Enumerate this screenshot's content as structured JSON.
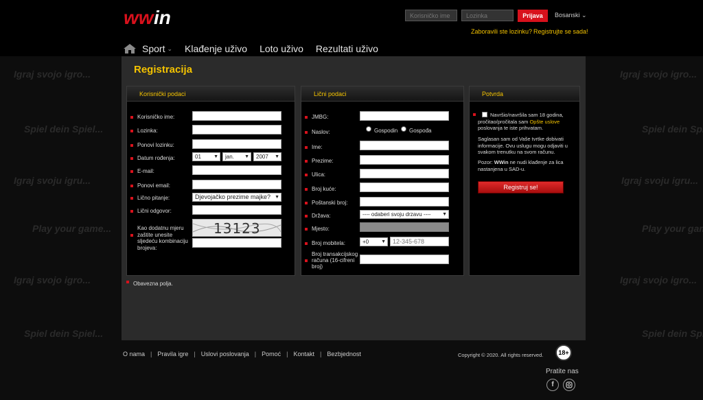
{
  "header": {
    "logo_text": "WWIN",
    "username_placeholder": "Korisničko ime",
    "password_placeholder": "Lozinka",
    "login_label": "Prijava",
    "language": "Bosanski",
    "forgot_password": "Zaboravili ste lozinku?",
    "register_now": "Registrujte se sada!"
  },
  "nav": {
    "items": [
      "Sport",
      "Klađenje uživo",
      "Loto uživo",
      "Rezultati uživo"
    ]
  },
  "background_text": {
    "a": "Igraj svojo igro...",
    "b": "Spiel dein Spiel...",
    "c": "Igraj svoju igru...",
    "d": "Play your game..."
  },
  "page_title": "Registracija",
  "account": {
    "heading": "Korisnički podaci",
    "username_label": "Korisničko ime:",
    "password_label": "Lozinka:",
    "repeat_password_label": "Ponovi lozinku:",
    "dob_label": "Datum rođenja:",
    "dob_day": "01",
    "dob_month": "jan.",
    "dob_year": "2007",
    "email_label": "E-mail:",
    "repeat_email_label": "Ponovi email:",
    "question_label": "Lično pitanje:",
    "question_value": "Djevojačko prezime majke?",
    "answer_label": "Lični odgovor:",
    "captcha_label": "Kao dodatnu mjeru zaštite unesite sljedeću kombinaciju brojeva:",
    "captcha_value": "13123"
  },
  "personal": {
    "heading": "Lični podaci",
    "jmbg_label": "JMBG:",
    "title_label": "Naslov:",
    "mr_label": "Gospodin",
    "mrs_label": "Gospođa",
    "name_label": "Ime:",
    "surname_label": "Prezime:",
    "street_label": "Ulica:",
    "house_label": "Broj kuće:",
    "postal_label": "Poštanski broj:",
    "country_label": "Država:",
    "country_value": "---- odaberi svoju drzavu ----",
    "city_label": "Mjesto:",
    "mobile_label": "Broj mobitela:",
    "mobile_prefix": "+0",
    "mobile_placeholder": "12-345-678",
    "account_label": "Broj transakcijskog računa (16-cifreni broj)"
  },
  "confirm": {
    "heading": "Potvrda",
    "age_text_1": "Navršio/navršila sam 18 godina, pročitao/pročitala sam ",
    "terms_link": "Opšte uslove",
    "age_text_2": " poslovanja te iste prihvatam.",
    "info_text": "Saglasan sam od Vaše tvrtke dobivati informacije. Ovu uslugu mogu odjaviti u svakom trenutku na svom računu.",
    "warning_prefix": "Pozor: ",
    "warning_brand": "WWin",
    "warning_text": " ne nudi klađenje za lica nastanjena u SAD-u.",
    "register_button": "Registruj se!"
  },
  "required_note": "Obavezna polja.",
  "footer": {
    "links": [
      "O nama",
      "Pravila igre",
      "Uslovi poslovanja",
      "Pomoć",
      "Kontakt",
      "Bezbjednost"
    ],
    "copyright": "Copyright © 2020. All rights reserved.",
    "age_badge": "18+",
    "follow": "Pratite nas"
  },
  "colors": {
    "accent": "#f4c300",
    "brand_red": "#d8111c"
  }
}
